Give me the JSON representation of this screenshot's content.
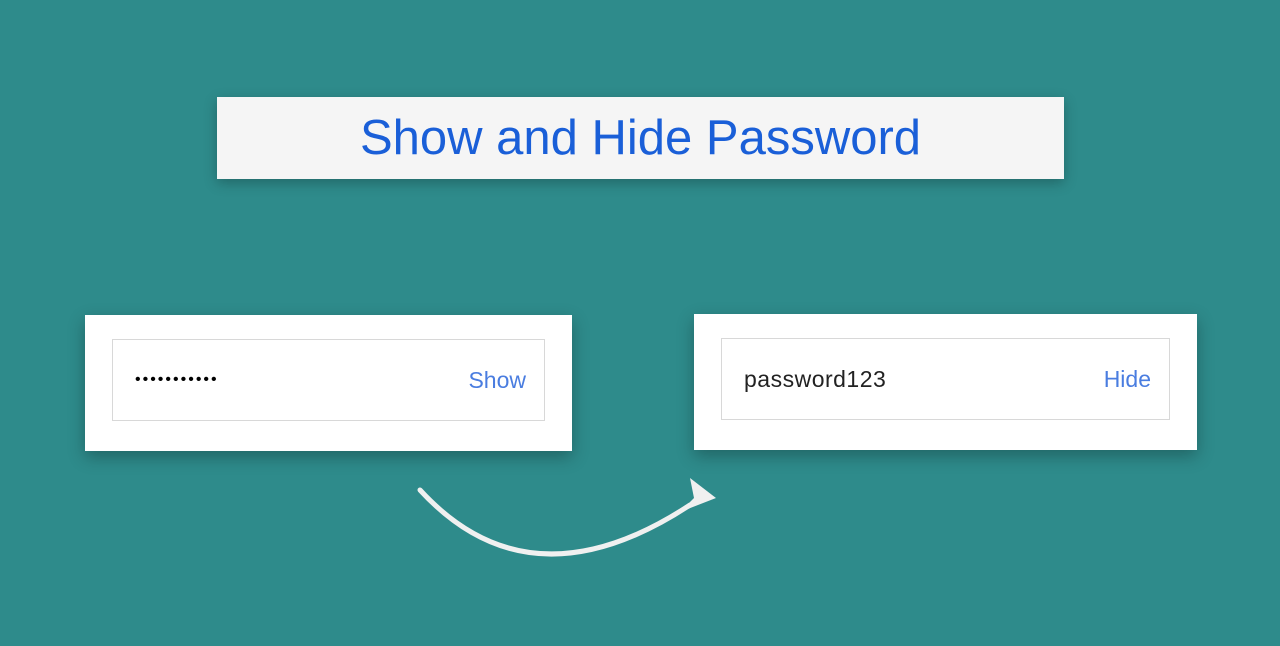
{
  "title": "Show and Hide Password",
  "left_card": {
    "masked_value": "•••••••••••",
    "toggle_label": "Show"
  },
  "right_card": {
    "plain_value": "password123",
    "toggle_label": "Hide"
  }
}
